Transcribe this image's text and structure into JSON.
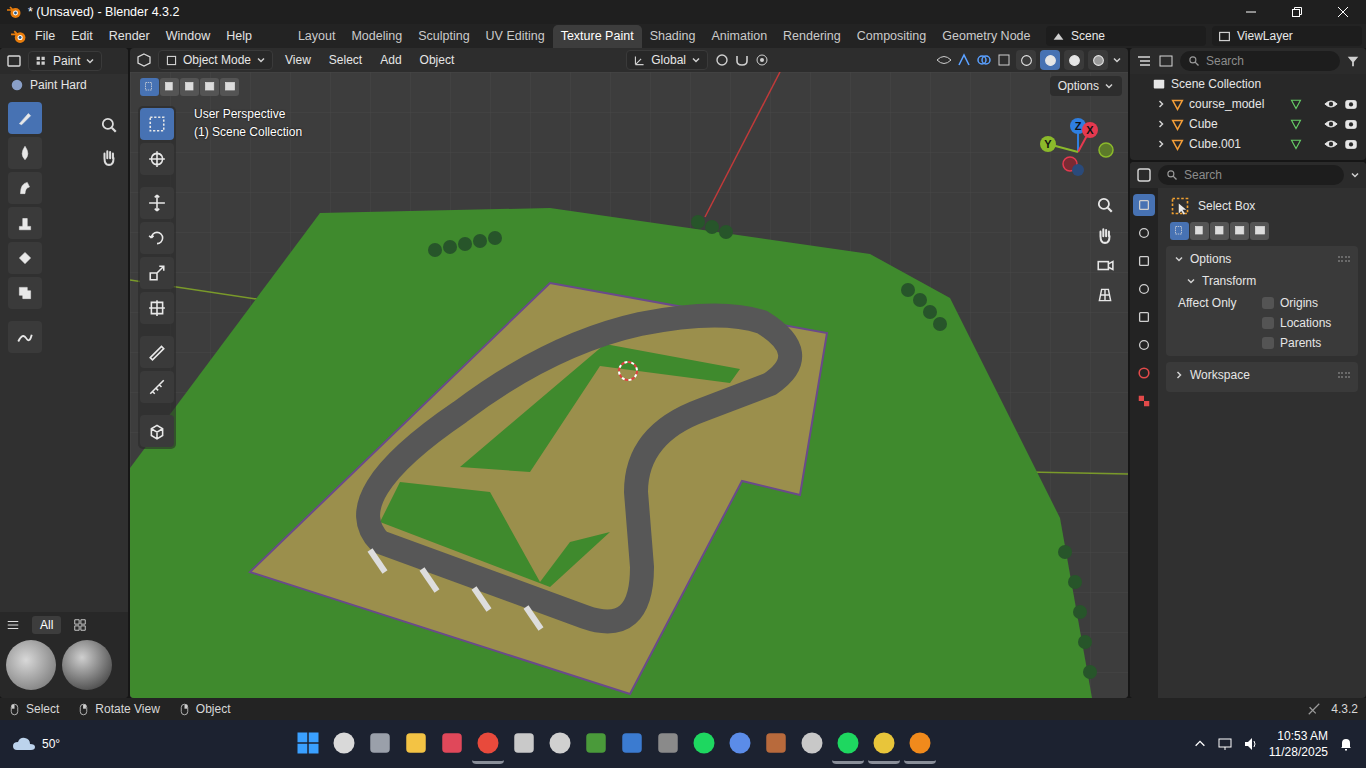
{
  "window": {
    "title": "* (Unsaved) - Blender 4.3.2"
  },
  "menus": [
    "File",
    "Edit",
    "Render",
    "Window",
    "Help"
  ],
  "workspaces": [
    {
      "label": "Layout",
      "selected": false
    },
    {
      "label": "Modeling",
      "selected": false
    },
    {
      "label": "Sculpting",
      "selected": false
    },
    {
      "label": "UV Editing",
      "selected": false
    },
    {
      "label": "Texture Paint",
      "selected": true
    },
    {
      "label": "Shading",
      "selected": false
    },
    {
      "label": "Animation",
      "selected": false
    },
    {
      "label": "Rendering",
      "selected": false
    },
    {
      "label": "Compositing",
      "selected": false
    },
    {
      "label": "Geometry Node",
      "selected": false
    }
  ],
  "scene": {
    "name": "Scene"
  },
  "view_layer": {
    "name": "ViewLayer"
  },
  "left_editor": {
    "mode": "Paint",
    "brush": "Paint Hard",
    "tools": [
      {
        "selected": true
      },
      {
        "selected": false
      },
      {
        "selected": false
      },
      {
        "selected": false
      },
      {
        "selected": false
      },
      {
        "selected": false
      },
      {
        "selected": false
      }
    ],
    "asset_shelf": {
      "tab": {
        "label": "All",
        "selected": true
      }
    }
  },
  "viewport": {
    "mode": "Object Mode",
    "menus": [
      "View",
      "Select",
      "Add",
      "Object"
    ],
    "orientation": "Global",
    "options": "Options",
    "select_modes": [
      {
        "selected": true
      },
      {
        "selected": false
      },
      {
        "selected": false
      },
      {
        "selected": false
      },
      {
        "selected": false
      }
    ],
    "shading": [
      {
        "selected": false
      },
      {
        "selected": true
      },
      {
        "selected": false
      },
      {
        "selected": false
      }
    ],
    "info": [
      "User Perspective",
      "(1) Scene Collection"
    ],
    "tools": [
      {
        "selected": true
      },
      {
        "selected": false
      },
      {
        "selected": false
      },
      {
        "selected": false
      },
      {
        "selected": false
      },
      {
        "selected": false
      },
      {
        "selected": false
      },
      {
        "selected": false
      },
      {
        "selected": false
      }
    ],
    "gizmo": [
      {
        "label": "Z",
        "color": "#2f7fe0"
      },
      {
        "label": "X",
        "color": "#e5394f"
      },
      {
        "label": "Y",
        "color": "#8bb92b"
      }
    ]
  },
  "outliner": {
    "search": "Search",
    "root": "Scene Collection",
    "items": [
      {
        "name": "course_model",
        "expanded": false,
        "visible": true,
        "renderable": true
      },
      {
        "name": "Cube",
        "expanded": false,
        "visible": true,
        "renderable": true
      },
      {
        "name": "Cube.001",
        "expanded": false,
        "visible": true,
        "renderable": true
      }
    ]
  },
  "properties": {
    "search": "Search",
    "tabs": [
      {
        "selected": true
      },
      {
        "selected": false
      },
      {
        "selected": false
      },
      {
        "selected": false
      },
      {
        "selected": false
      },
      {
        "selected": false
      },
      {
        "selected": false
      },
      {
        "selected": false
      }
    ],
    "tool": "Select Box",
    "select_modes": [
      {
        "selected": true
      },
      {
        "selected": false
      },
      {
        "selected": false
      },
      {
        "selected": false
      },
      {
        "selected": false
      }
    ],
    "options_panel": {
      "label": "Options",
      "expanded": true,
      "subpanel": {
        "label": "Transform",
        "expanded": true,
        "group_label": "Affect Only",
        "checkboxes": [
          {
            "label": "Origins",
            "checked": false
          },
          {
            "label": "Locations",
            "checked": false
          },
          {
            "label": "Parents",
            "checked": false
          }
        ]
      }
    },
    "workspace_panel": {
      "label": "Workspace",
      "expanded": false
    }
  },
  "status_bar": {
    "hints": [
      "Select",
      "Rotate View",
      "Object"
    ],
    "version": "4.3.2"
  },
  "taskbar": {
    "weather": "50°",
    "time": "10:53 AM",
    "date": "11/28/2025"
  }
}
